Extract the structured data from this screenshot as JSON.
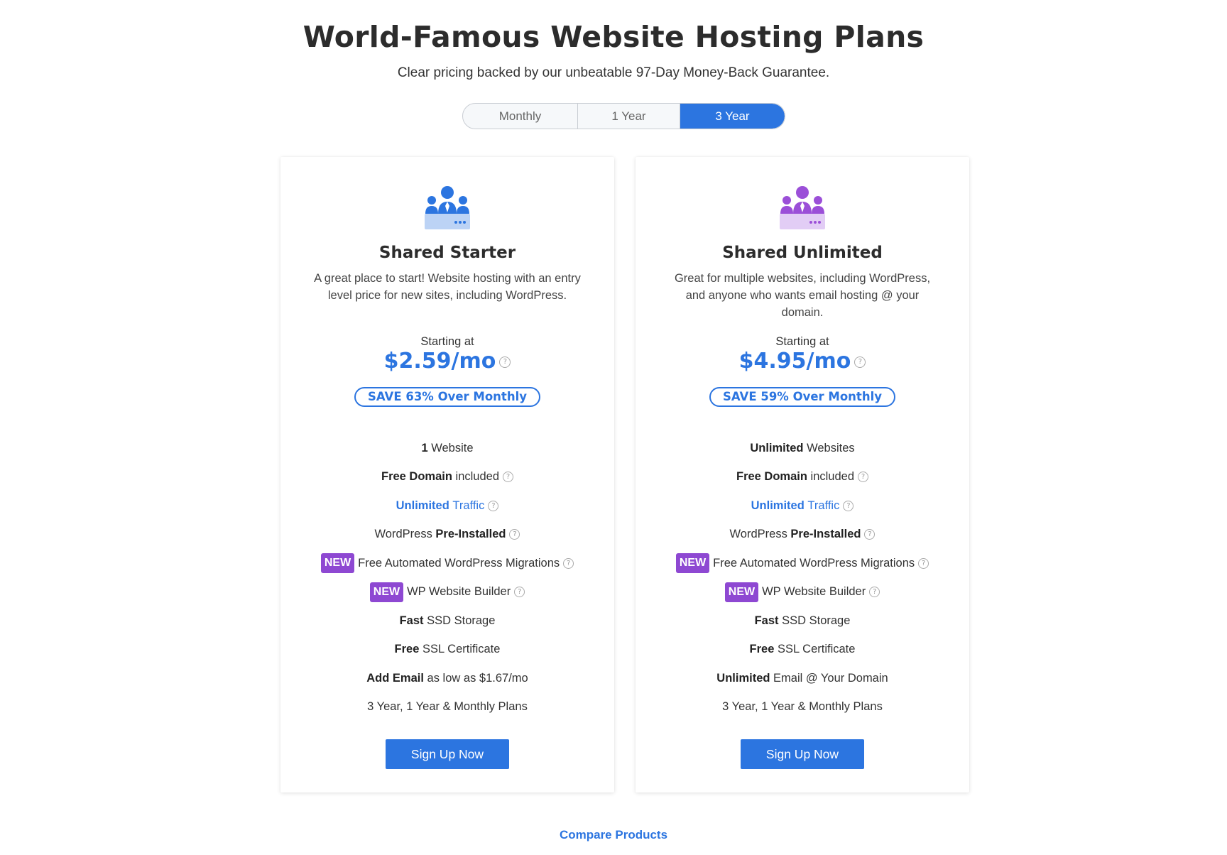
{
  "header": {
    "title": "World-Famous Website Hosting Plans",
    "subtitle": "Clear pricing backed by our unbeatable 97-Day Money-Back Guarantee."
  },
  "billing_toggle": {
    "options": [
      "Monthly",
      "1 Year",
      "3 Year"
    ],
    "selected": "3 Year"
  },
  "plans": [
    {
      "name": "Shared Starter",
      "icon": "users-group-icon",
      "icon_color": "#2c75e0",
      "description": "A great place to start! Website hosting with an entry level price for new sites, including WordPress.",
      "starting_label": "Starting at",
      "price": "$2.59/mo",
      "save_badge": "SAVE 63% Over Monthly",
      "features": {
        "f1_bold": "1",
        "f1_text": "Website",
        "f2_bold": "Free Domain",
        "f2_text": "included",
        "f3_bold": "Unlimited",
        "f3_text": "Traffic",
        "f4_text": "WordPress",
        "f4_bold": "Pre-Installed",
        "f5_tag": "NEW",
        "f5_text": "Free Automated WordPress Migrations",
        "f6_tag": "NEW",
        "f6_text": "WP Website Builder",
        "f7_bold": "Fast",
        "f7_text": "SSD Storage",
        "f8_bold": "Free",
        "f8_text": "SSL Certificate",
        "f9_bold": "Add Email",
        "f9_text": "as low as $1.67/mo",
        "f10_text": "3 Year, 1 Year & Monthly Plans"
      },
      "cta": "Sign Up Now"
    },
    {
      "name": "Shared Unlimited",
      "icon": "users-group-icon",
      "icon_color": "#9b4fd8",
      "description": "Great for multiple websites, including WordPress, and anyone who wants email hosting @ your domain.",
      "starting_label": "Starting at",
      "price": "$4.95/mo",
      "save_badge": "SAVE 59% Over Monthly",
      "features": {
        "f1_bold": "Unlimited",
        "f1_text": "Websites",
        "f2_bold": "Free Domain",
        "f2_text": "included",
        "f3_bold": "Unlimited",
        "f3_text": "Traffic",
        "f4_text": "WordPress",
        "f4_bold": "Pre-Installed",
        "f5_tag": "NEW",
        "f5_text": "Free Automated WordPress Migrations",
        "f6_tag": "NEW",
        "f6_text": "WP Website Builder",
        "f7_bold": "Fast",
        "f7_text": "SSD Storage",
        "f8_bold": "Free",
        "f8_text": "SSL Certificate",
        "f9_bold": "Unlimited",
        "f9_text": "Email @ Your Domain",
        "f10_text": "3 Year, 1 Year & Monthly Plans"
      },
      "cta": "Sign Up Now"
    }
  ],
  "footer": {
    "compare_link": "Compare Products"
  },
  "colors": {
    "accent": "#2c75e0",
    "new_tag": "#8e48d2"
  }
}
